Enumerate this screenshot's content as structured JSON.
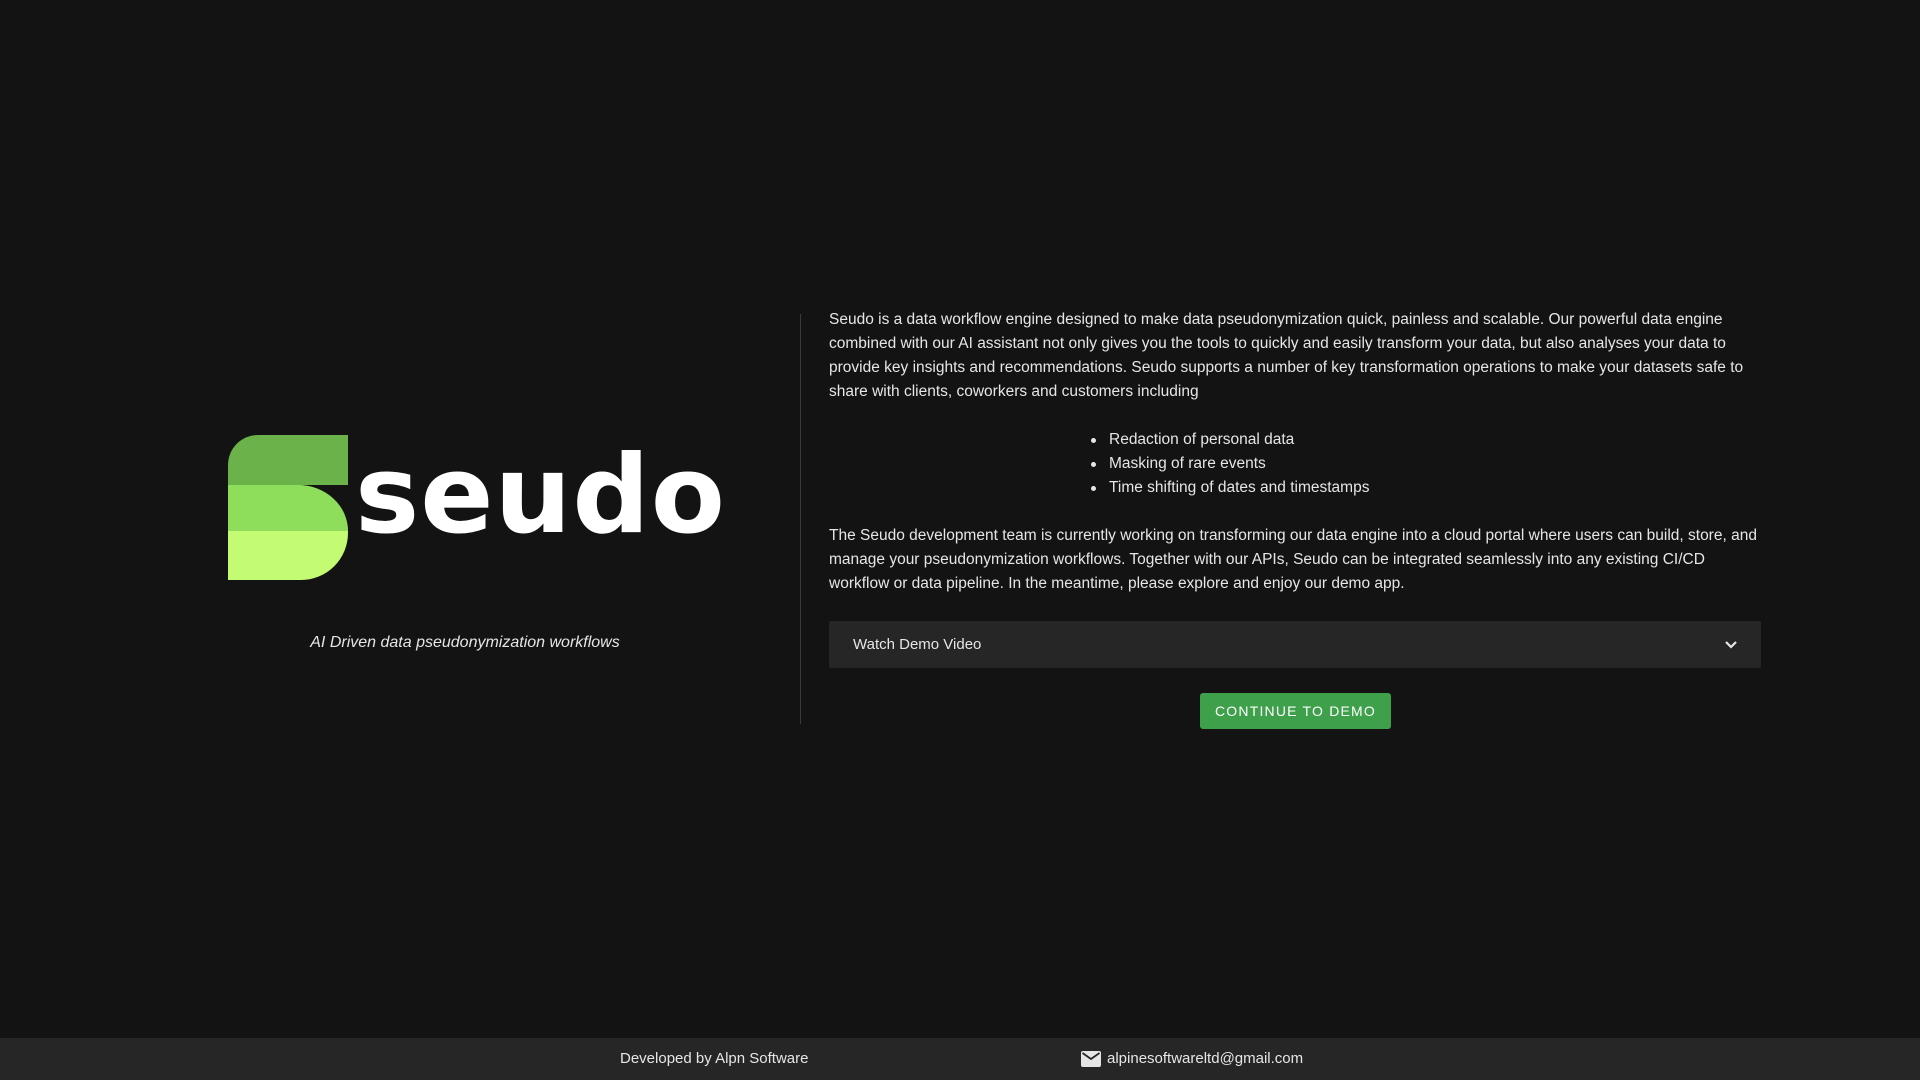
{
  "brand": {
    "wordmark": "seudo",
    "tagline": "AI Driven data pseudonymization workflows",
    "logo_icon": "seudo-leaf-logo",
    "colors": {
      "leaf_dark": "#6bb24a",
      "leaf_mid": "#8ede5c",
      "leaf_light": "#c3fb72"
    }
  },
  "intro": {
    "paragraph": "Seudo is a data workflow engine designed to make data pseudonymization quick, painless and scalable. Our powerful data engine combined with our AI assistant not only gives you the tools to quickly and easily transform your data, but also analyses your data to provide key insights and recommendations. Seudo supports a number of key transformation operations to make your datasets safe to share with clients, coworkers and customers including"
  },
  "features": [
    "Redaction of personal data",
    "Masking of rare events",
    "Time shifting of dates and timestamps"
  ],
  "roadmap": {
    "paragraph": "The Seudo development team is currently working on transforming our data engine into a cloud portal where users can build, store, and manage your pseudonymization workflows. Together with our APIs, Seudo can be integrated seamlessly into any existing CI/CD workflow or data pipeline. In the meantime, please explore and enjoy our demo app."
  },
  "demo_video": {
    "label": "Watch Demo Video",
    "icon": "chevron-down-icon"
  },
  "cta": {
    "label": "CONTINUE TO DEMO",
    "color": "#3ea04a"
  },
  "footer": {
    "credit": "Developed by Alpn Software",
    "email": "alpinesoftwareltd@gmail.com",
    "email_icon": "mail-icon"
  },
  "theme": {
    "background": "#131313",
    "panel": "#262626",
    "text": "#e6e6e6"
  }
}
